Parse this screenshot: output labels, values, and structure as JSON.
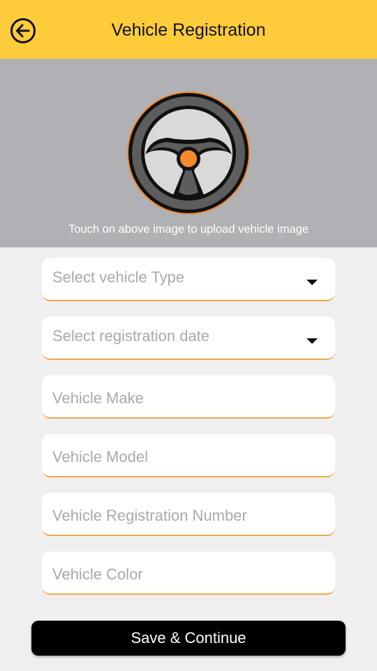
{
  "header": {
    "title": "Vehicle Registration",
    "back_icon": "arrow-left-circle-icon",
    "background_color": "#fecb3b"
  },
  "vehicle_image": {
    "icon": "steering-wheel-icon",
    "hint": "Touch on above image to upload vehicle image",
    "accent_color": "#f48a2a"
  },
  "form": {
    "vehicle_type": {
      "placeholder": "Select vehicle Type"
    },
    "registration_date": {
      "placeholder": "Select registration date"
    },
    "make": {
      "placeholder": "Vehicle Make"
    },
    "model": {
      "placeholder": "Vehicle Model"
    },
    "registration_number": {
      "placeholder": "Vehicle Registration Number"
    },
    "color": {
      "placeholder": "Vehicle Color"
    }
  },
  "actions": {
    "save_label": "Save & Continue"
  }
}
